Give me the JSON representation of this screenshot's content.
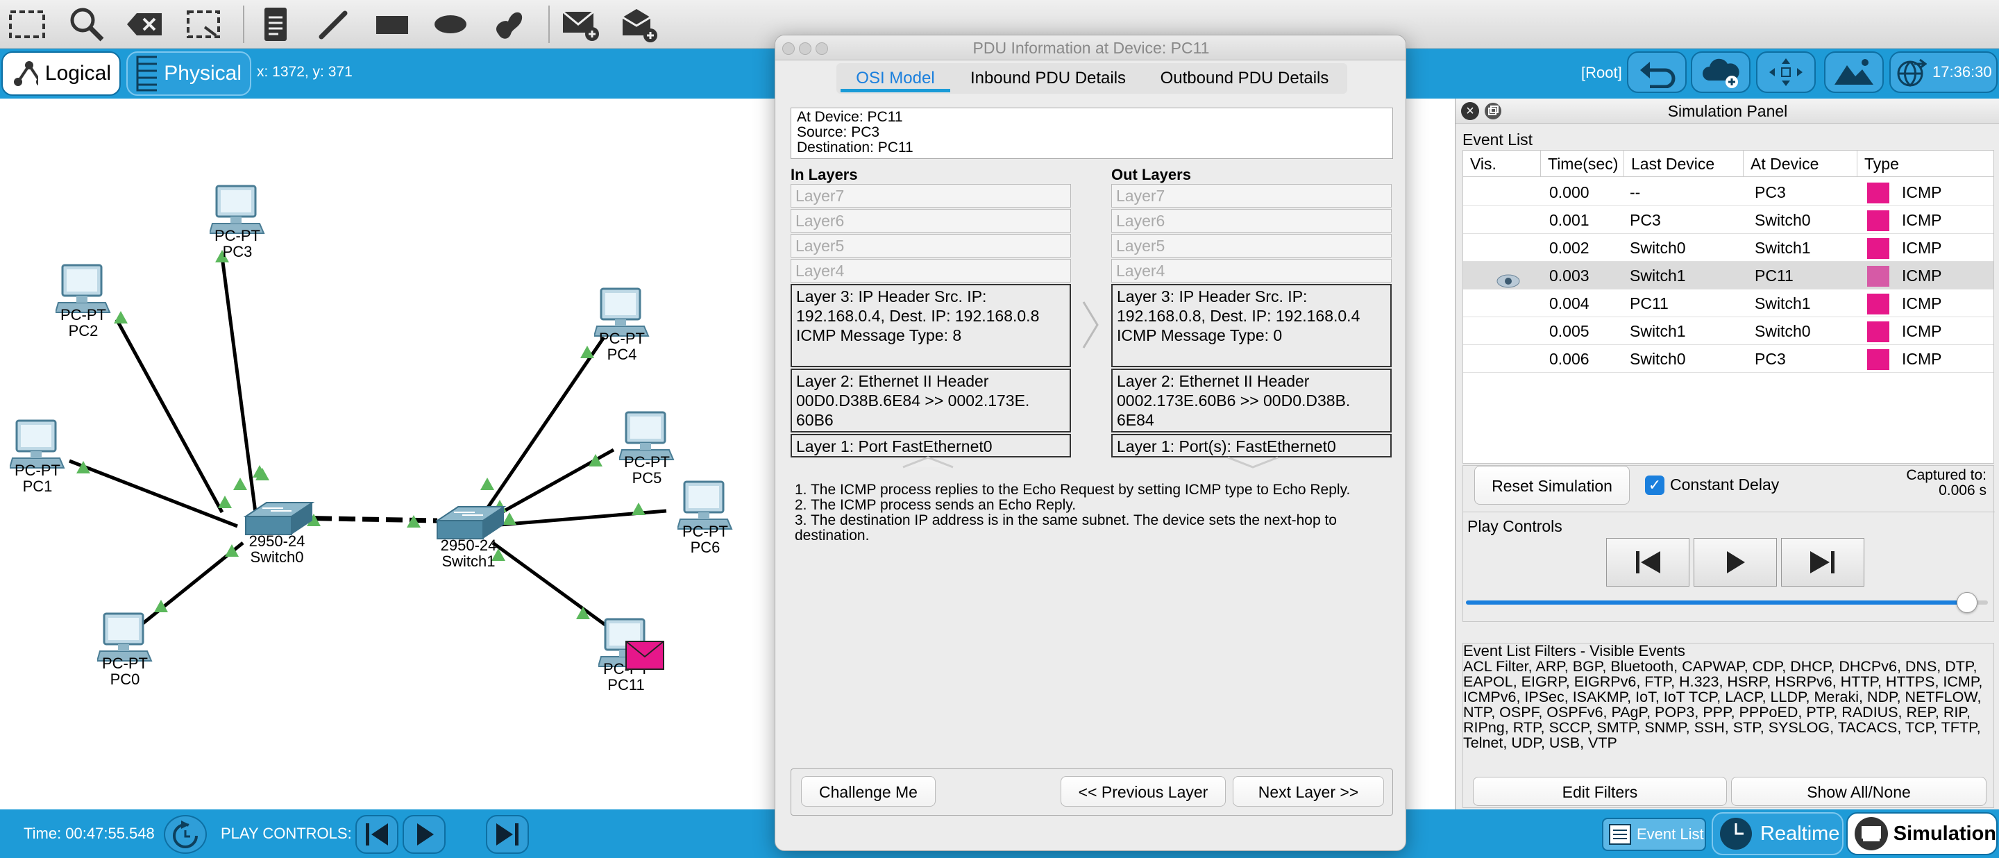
{
  "toolbar": {
    "icons": [
      "select-icon",
      "zoom-icon",
      "delete-icon",
      "resize-icon",
      "note-icon",
      "line-draw-icon",
      "rectangle-icon",
      "ellipse-icon",
      "freeform-icon",
      "add-simple-pdu-icon",
      "add-complex-pdu-icon"
    ]
  },
  "bluebar": {
    "logical_label": "Logical",
    "physical_label": "Physical",
    "coords": "x: 1372, y: 371",
    "root_label": "[Root]",
    "clock": "17:36:30"
  },
  "bottombar": {
    "time": "Time: 00:47:55.548",
    "play_label": "PLAY CONTROLS:",
    "event_list_label": "Event List",
    "realtime_label": "Realtime",
    "simulation_label": "Simulation"
  },
  "network": {
    "nodes": [
      {
        "type": "PC-PT",
        "name": "PC3"
      },
      {
        "type": "PC-PT",
        "name": "PC2"
      },
      {
        "type": "PC-PT",
        "name": "PC1"
      },
      {
        "type": "PC-PT",
        "name": "PC0"
      },
      {
        "type": "2950-24",
        "name": "Switch0"
      },
      {
        "type": "2950-24",
        "name": "Switch1"
      },
      {
        "type": "PC-PT",
        "name": "PC4"
      },
      {
        "type": "PC-PT",
        "name": "PC5"
      },
      {
        "type": "PC-PT",
        "name": "PC6"
      },
      {
        "type": "PC-PT",
        "name": "PC11"
      }
    ]
  },
  "pdu": {
    "title": "PDU Information at Device: PC11",
    "tabs": [
      "OSI Model",
      "Inbound PDU Details",
      "Outbound PDU Details"
    ],
    "info": [
      "At Device: PC11",
      "Source: PC3",
      "Destination: PC11"
    ],
    "in_title": "In Layers",
    "out_title": "Out Layers",
    "in_layers": [
      "Layer7",
      "Layer6",
      "Layer5",
      "Layer4",
      "Layer 3: IP Header Src. IP: 192.168.0.4, Dest. IP: 192.168.0.8 ICMP Message Type: 8",
      "Layer 2: Ethernet II Header 00D0.D38B.6E84 >> 0002.173E. 60B6",
      "Layer 1: Port FastEthernet0"
    ],
    "out_layers": [
      "Layer7",
      "Layer6",
      "Layer5",
      "Layer4",
      "Layer 3: IP Header Src. IP: 192.168.0.8, Dest. IP: 192.168.0.4 ICMP Message Type: 0",
      "Layer 2: Ethernet II Header 0002.173E.60B6 >> 00D0.D38B. 6E84",
      "Layer 1: Port(s): FastEthernet0"
    ],
    "explanations": [
      "1. The ICMP process replies to the Echo Request by setting ICMP type to Echo Reply.",
      "2. The ICMP process sends an Echo Reply.",
      "3. The destination IP address is in the same subnet. The device sets the next-hop to destination."
    ],
    "challenge_label": "Challenge Me",
    "prev_label": "<< Previous Layer",
    "next_label": "Next Layer >>"
  },
  "sim": {
    "title": "Simulation Panel",
    "event_list_title": "Event List",
    "columns": [
      "Vis.",
      "Time(sec)",
      "Last Device",
      "At Device",
      "Type"
    ],
    "events": [
      {
        "time": "0.000",
        "last": "--",
        "at": "PC3",
        "type": "ICMP"
      },
      {
        "time": "0.001",
        "last": "PC3",
        "at": "Switch0",
        "type": "ICMP"
      },
      {
        "time": "0.002",
        "last": "Switch0",
        "at": "Switch1",
        "type": "ICMP"
      },
      {
        "time": "0.003",
        "last": "Switch1",
        "at": "PC11",
        "type": "ICMP"
      },
      {
        "time": "0.004",
        "last": "PC11",
        "at": "Switch1",
        "type": "ICMP"
      },
      {
        "time": "0.005",
        "last": "Switch1",
        "at": "Switch0",
        "type": "ICMP"
      },
      {
        "time": "0.006",
        "last": "Switch0",
        "at": "PC3",
        "type": "ICMP"
      }
    ],
    "selected_row": 3,
    "reset_label": "Reset Simulation",
    "constant_delay_label": "Constant Delay",
    "constant_delay_checked": true,
    "captured_label": "Captured to:",
    "captured_value": "0.006 s",
    "play_controls_title": "Play Controls",
    "speed_fraction": 0.96,
    "filters_title": "Event List Filters - Visible Events",
    "filters_text": "ACL Filter, ARP, BGP, Bluetooth, CAPWAP, CDP, DHCP, DHCPv6, DNS, DTP, EAPOL, EIGRP, EIGRPv6, FTP, H.323, HSRP, HSRPv6, HTTP, HTTPS, ICMP, ICMPv6, IPSec, ISAKMP, IoT, IoT TCP, LACP, LLDP, Meraki, NDP, NETFLOW, NTP, OSPF, OSPFv6, PAgP, POP3, PPP, PPPoED, PTP, RADIUS, REP, RIP, RIPng, RTP, SCCP, SMTP, SNMP, SSH, STP, SYSLOG, TACACS, TCP, TFTP, Telnet, UDP, USB, VTP",
    "edit_filters_label": "Edit Filters",
    "show_all_label": "Show All/None"
  },
  "colors": {
    "accent": "#1e9bd7",
    "icmp": "#e6178a",
    "link_up": "#5cb85c"
  }
}
